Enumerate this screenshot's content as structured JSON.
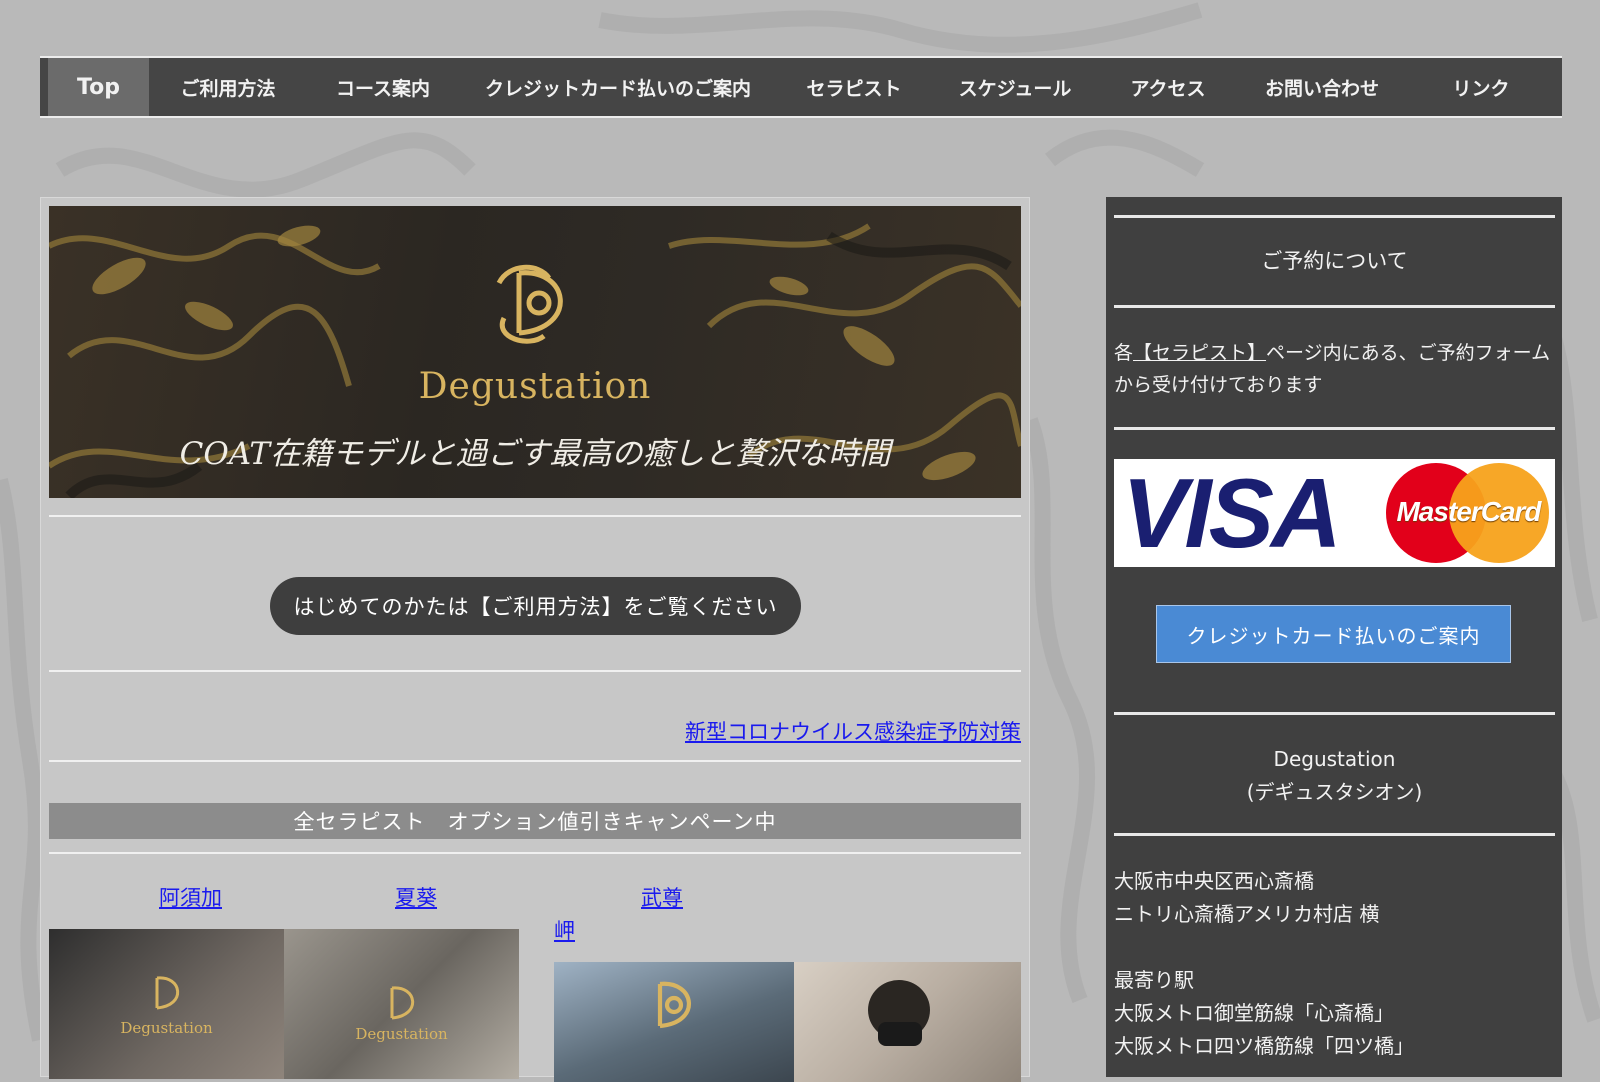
{
  "nav": {
    "items": [
      {
        "label": "Top",
        "active": true
      },
      {
        "label": "ご利用方法"
      },
      {
        "label": "コース案内"
      },
      {
        "label": "クレジットカード払いのご案内"
      },
      {
        "label": "セラピスト"
      },
      {
        "label": "スケジュール"
      },
      {
        "label": "アクセス"
      },
      {
        "label": "お問い合わせ"
      },
      {
        "label": "リンク"
      }
    ]
  },
  "hero": {
    "brand": "Degustation",
    "tagline": "COAT在籍モデルと過ごす最高の癒しと贅沢な時間"
  },
  "main": {
    "first_time_button": "はじめてのかたは【ご利用方法】をご覧ください",
    "covid_link": "新型コロナウイルス感染症予防対策",
    "campaign": "全セラピスト　オプション値引きキャンペーン中",
    "therapists": [
      "阿須加",
      "夏葵",
      "武尊",
      "岬"
    ],
    "watermark": "Degustation"
  },
  "sidebar": {
    "reservation_title": "ご予約について",
    "reservation_prefix": "各",
    "reservation_link": "【セラピスト】",
    "reservation_text": "ページ内にある、ご予約フォームから受け付けております",
    "card_visa": "VISA",
    "card_mastercard": "MasterCard",
    "credit_button": "クレジットカード払いのご案内",
    "shop_name": "Degustation",
    "shop_kana": "(デギュスタシオン)",
    "address_line1": "大阪市中央区西心斎橋",
    "address_line2": "ニトリ心斎橋アメリカ村店 横",
    "station_label": "最寄り駅",
    "station1": "大阪メトロ御堂筋線「心斎橋」",
    "station2": "大阪メトロ四ツ橋筋線「四ツ橋」"
  },
  "colors": {
    "nav_bg": "#454545",
    "sidebar_bg": "#404040",
    "link": "#1a1aee",
    "gold": "#d8b460",
    "credit_button": "#4a8ad4"
  }
}
